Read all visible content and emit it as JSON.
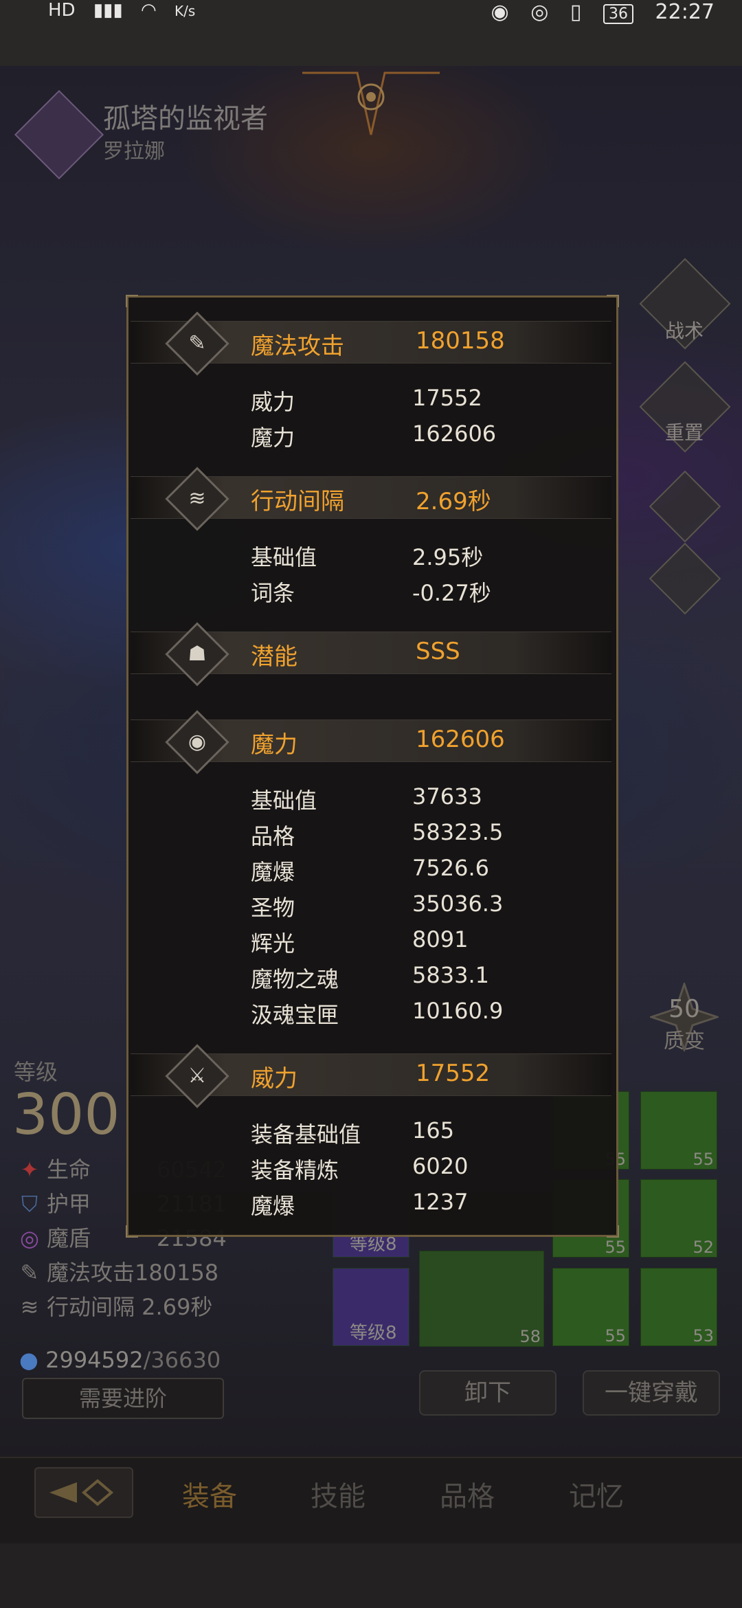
{
  "status_bar": {
    "left_icons": [
      "HD",
      "signal-icon",
      "wifi-icon"
    ],
    "speed": "K/s",
    "battery": "36",
    "time": "22:27"
  },
  "hero": {
    "title": "孤塔的监视者",
    "name": "罗拉娜"
  },
  "side_buttons": [
    {
      "label": "战术",
      "icon": "banner-icon"
    },
    {
      "label": "重置",
      "icon": "helmet-icon"
    }
  ],
  "level": {
    "label": "等级",
    "value": "300"
  },
  "stats": [
    {
      "icon": "life-icon",
      "label": "生命",
      "value": "60542"
    },
    {
      "icon": "armor-icon",
      "label": "护甲",
      "value": "21181"
    },
    {
      "icon": "shield-icon",
      "label": "魔盾",
      "value": "21584"
    },
    {
      "icon": "magic-attack-icon",
      "label": "魔法攻击180158",
      "value": ""
    },
    {
      "icon": "speed-icon",
      "label": "行动间隔 2.69秒",
      "value": ""
    }
  ],
  "exp": {
    "current": "2994592",
    "max": "/36630"
  },
  "need_advance": "需要进阶",
  "quality": {
    "value": "50",
    "label": "质变"
  },
  "equipment": {
    "slots": [
      {
        "level": "55"
      },
      {
        "level": "55"
      },
      {
        "level": "55"
      },
      {
        "level": "52"
      },
      {
        "level": "58"
      },
      {
        "level": "55"
      },
      {
        "level": "53"
      }
    ],
    "rank_tag": "等级8",
    "unequip": "卸下",
    "equip_all": "一键穿戴"
  },
  "nav": {
    "items": [
      "装备",
      "技能",
      "品格",
      "记忆"
    ],
    "active": "装备"
  },
  "popup": {
    "sections": [
      {
        "icon": "magic-attack-icon",
        "name": "魔法攻击",
        "value": "180158",
        "rows": [
          {
            "label": "威力",
            "value": "17552"
          },
          {
            "label": "魔力",
            "value": "162606"
          }
        ]
      },
      {
        "icon": "speed-icon",
        "name": "行动间隔",
        "value": "2.69秒",
        "rows": [
          {
            "label": "基础值",
            "value": "2.95秒"
          },
          {
            "label": "词条",
            "value": "-0.27秒"
          }
        ]
      },
      {
        "icon": "potential-icon",
        "name": "潜能",
        "value": "SSS",
        "rows": []
      },
      {
        "icon": "mana-icon",
        "name": "魔力",
        "value": "162606",
        "rows": [
          {
            "label": "基础值",
            "value": "37633"
          },
          {
            "label": "品格",
            "value": "58323.5"
          },
          {
            "label": "魔爆",
            "value": "7526.6"
          },
          {
            "label": "圣物",
            "value": "35036.3"
          },
          {
            "label": "辉光",
            "value": "8091"
          },
          {
            "label": "魔物之魂",
            "value": "5833.1"
          },
          {
            "label": "汲魂宝匣",
            "value": "10160.9"
          }
        ]
      },
      {
        "icon": "power-icon",
        "name": "威力",
        "value": "17552",
        "rows": [
          {
            "label": "装备基础值",
            "value": "165"
          },
          {
            "label": "装备精炼",
            "value": "6020"
          },
          {
            "label": "魔爆",
            "value": "1237"
          }
        ]
      }
    ]
  }
}
